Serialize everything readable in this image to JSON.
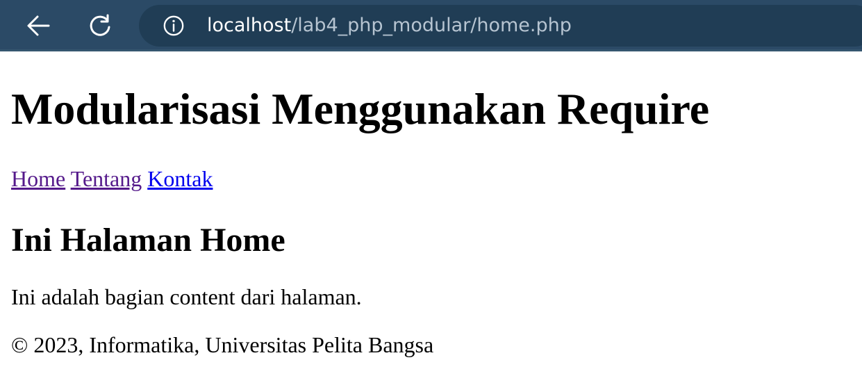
{
  "browser": {
    "back_icon": "back-arrow-icon",
    "reload_icon": "reload-icon",
    "info_icon": "info-icon",
    "url_host": "localhost",
    "url_path": "/lab4_php_modular/home.php",
    "bar_color": "#2b4a66",
    "address_color": "#203d55"
  },
  "page": {
    "title": "Modularisasi Menggunakan Require",
    "nav": {
      "home": "Home",
      "tentang": "Tentang",
      "kontak": "Kontak"
    },
    "heading": "Ini Halaman Home",
    "content": "Ini adalah bagian content dari halaman.",
    "footer": "© 2023, Informatika, Universitas Pelita Bangsa"
  },
  "colors": {
    "visited_link": "#551a8b",
    "unvisited_link": "#0000ee"
  }
}
